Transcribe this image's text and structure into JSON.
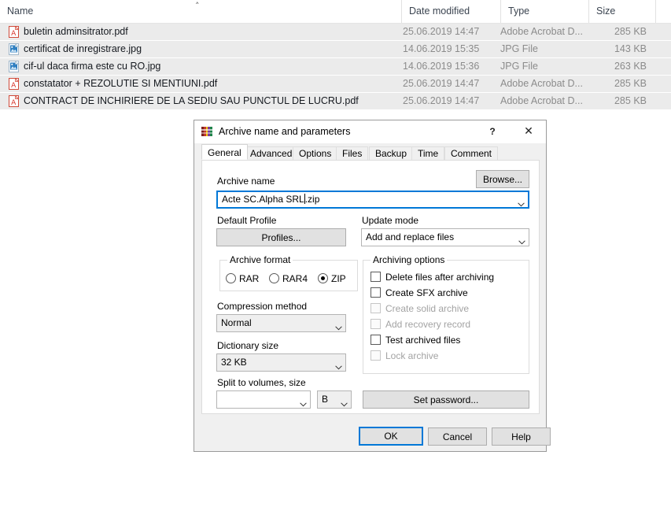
{
  "explorer": {
    "columns": [
      {
        "label": "Name"
      },
      {
        "label": "Date modified"
      },
      {
        "label": "Type"
      },
      {
        "label": "Size"
      }
    ],
    "sort_indicator": "˄",
    "rows": [
      {
        "icon": "pdf-file-icon",
        "name": "buletin adminsitrator.pdf",
        "date": "25.06.2019 14:47",
        "type": "Adobe Acrobat D...",
        "size": "285 KB"
      },
      {
        "icon": "jpg-file-icon",
        "name": "certificat de inregistrare.jpg",
        "date": "14.06.2019 15:35",
        "type": "JPG File",
        "size": "143 KB"
      },
      {
        "icon": "jpg-file-icon",
        "name": "cif-ul daca firma este cu RO.jpg",
        "date": "14.06.2019 15:36",
        "type": "JPG File",
        "size": "263 KB"
      },
      {
        "icon": "pdf-file-icon",
        "name": "constatator + REZOLUTIE SI MENTIUNI.pdf",
        "date": "25.06.2019 14:47",
        "type": "Adobe Acrobat D...",
        "size": "285 KB"
      },
      {
        "icon": "pdf-file-icon",
        "name": "CONTRACT DE INCHIRIERE DE LA SEDIU SAU PUNCTUL DE LUCRU.pdf",
        "date": "25.06.2019 14:47",
        "type": "Adobe Acrobat D...",
        "size": "285 KB"
      }
    ]
  },
  "dialog": {
    "title": "Archive name and parameters",
    "icon": "winrar-books-icon",
    "help_button": "?",
    "close_button": "✕",
    "tabs": [
      {
        "label": "General",
        "active": true
      },
      {
        "label": "Advanced",
        "active": false
      },
      {
        "label": "Options",
        "active": false
      },
      {
        "label": "Files",
        "active": false
      },
      {
        "label": "Backup",
        "active": false
      },
      {
        "label": "Time",
        "active": false
      },
      {
        "label": "Comment",
        "active": false
      }
    ],
    "archive_name": {
      "label": "Archive name",
      "value_before_caret": "Acte SC.Alpha SRL",
      "value_after_caret": ".zip",
      "full_value": "Acte SC.Alpha SRL.zip",
      "browse_button": "Browse..."
    },
    "default_profile": {
      "label": "Default Profile",
      "button": "Profiles..."
    },
    "update_mode": {
      "label": "Update mode",
      "value": "Add and replace files"
    },
    "archive_format": {
      "label": "Archive format",
      "options": [
        {
          "label": "RAR",
          "checked": false
        },
        {
          "label": "RAR4",
          "checked": false
        },
        {
          "label": "ZIP",
          "checked": true
        }
      ]
    },
    "compression_method": {
      "label": "Compression method",
      "value": "Normal"
    },
    "dictionary_size": {
      "label": "Dictionary size",
      "value": "32 KB"
    },
    "split_volumes": {
      "label": "Split to volumes, size",
      "value": "",
      "unit": "B"
    },
    "archiving_options": {
      "label": "Archiving options",
      "items": [
        {
          "label": "Delete files after archiving",
          "checked": false,
          "disabled": false
        },
        {
          "label": "Create SFX archive",
          "checked": false,
          "disabled": false
        },
        {
          "label": "Create solid archive",
          "checked": false,
          "disabled": true
        },
        {
          "label": "Add recovery record",
          "checked": false,
          "disabled": true
        },
        {
          "label": "Test archived files",
          "checked": false,
          "disabled": false
        },
        {
          "label": "Lock archive",
          "checked": false,
          "disabled": true
        }
      ]
    },
    "set_password_button": "Set password...",
    "footer": {
      "ok": "OK",
      "cancel": "Cancel",
      "help": "Help"
    }
  },
  "colors": {
    "accent": "#0078d7",
    "row_background": "#ebebeb",
    "dialog_background": "#f0f0f0",
    "muted_text": "#8b8b8b",
    "disabled_text": "#a3a3a3"
  }
}
